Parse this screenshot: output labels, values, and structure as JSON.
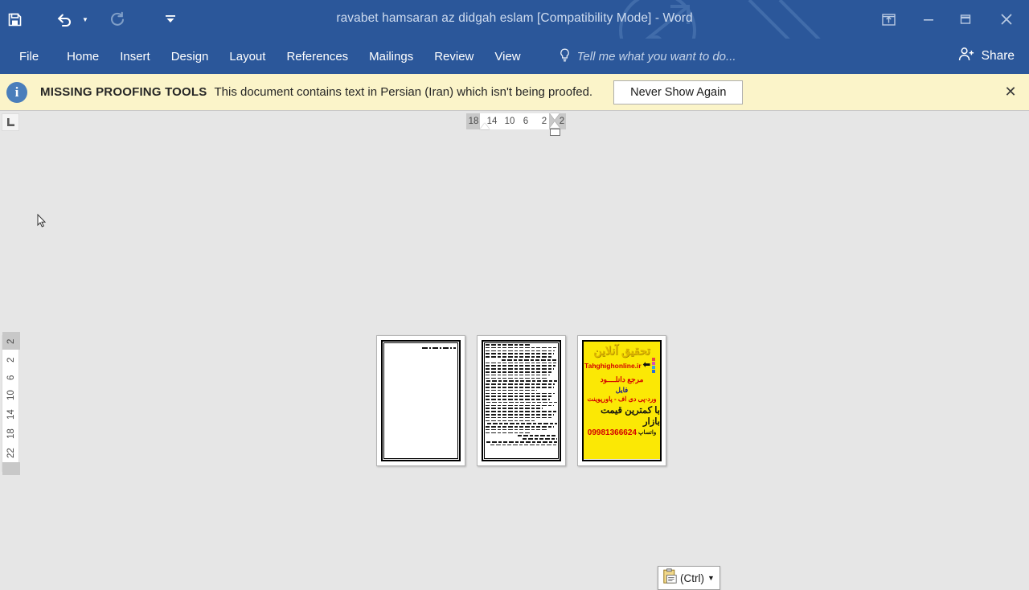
{
  "titlebar": {
    "document_title": "ravabet hamsaran az didgah eslam [Compatibility Mode] - Word",
    "quick_access": [
      {
        "name": "save-icon",
        "label": "Save"
      },
      {
        "name": "undo-icon",
        "label": "Undo"
      },
      {
        "name": "redo-icon",
        "label": "Redo"
      },
      {
        "name": "customize-qat-icon",
        "label": "Customize Quick Access Toolbar"
      }
    ],
    "window_controls": [
      {
        "name": "ribbon-display-options-icon",
        "label": "Ribbon Display Options"
      },
      {
        "name": "minimize-icon",
        "label": "Minimize"
      },
      {
        "name": "maximize-icon",
        "label": "Restore Down"
      },
      {
        "name": "close-icon",
        "label": "Close"
      }
    ],
    "bg_color": "#2b579a",
    "title_color": "#cfdcef"
  },
  "ribbon": {
    "tabs": [
      {
        "label": "File"
      },
      {
        "label": "Home"
      },
      {
        "label": "Insert"
      },
      {
        "label": "Design"
      },
      {
        "label": "Layout"
      },
      {
        "label": "References"
      },
      {
        "label": "Mailings"
      },
      {
        "label": "Review"
      },
      {
        "label": "View"
      }
    ],
    "tell_me_placeholder": "Tell me what you want to do...",
    "share_label": "Share"
  },
  "notification": {
    "title": "MISSING PROOFING TOOLS",
    "message": "This document contains text in Persian (Iran) which isn't being proofed.",
    "button_label": "Never Show Again",
    "close_label": "✕",
    "bg_color": "#fbf4c9"
  },
  "ruler": {
    "tab_selector_glyph": "⌞",
    "horizontal_ticks": [
      "18",
      "14",
      "10",
      "6",
      "2",
      "2"
    ],
    "vertical_ticks": [
      "2",
      "2",
      "6",
      "10",
      "14",
      "18",
      "22"
    ]
  },
  "document": {
    "zoom_view": "multiple-pages",
    "pages": [
      {
        "index": 1,
        "type": "bordered-blank",
        "header_rule": true,
        "line_count": 0
      },
      {
        "index": 2,
        "type": "bordered-text",
        "line_count": 34
      },
      {
        "index": 3,
        "type": "advertisement",
        "ad": {
          "bg_color": "#fbe805",
          "title": "تحقیق آنلاین",
          "website": "Tahghighonline.ir",
          "line2": "مرجع دانلــــود",
          "line3": "فایل",
          "line4": "ورد-پی دی اف - پاورپوینت",
          "line5": "با کمترین قیمت بازار",
          "phone": "09981366624",
          "whatsapp": "واتساپ",
          "title_color": "#e0b800",
          "accent_color": "#d40000"
        }
      }
    ]
  },
  "paste_options": {
    "label": "(Ctrl)",
    "caret": "▼",
    "icon_name": "clipboard-icon"
  },
  "workspace": {
    "bg_color": "#e6e6e6"
  }
}
